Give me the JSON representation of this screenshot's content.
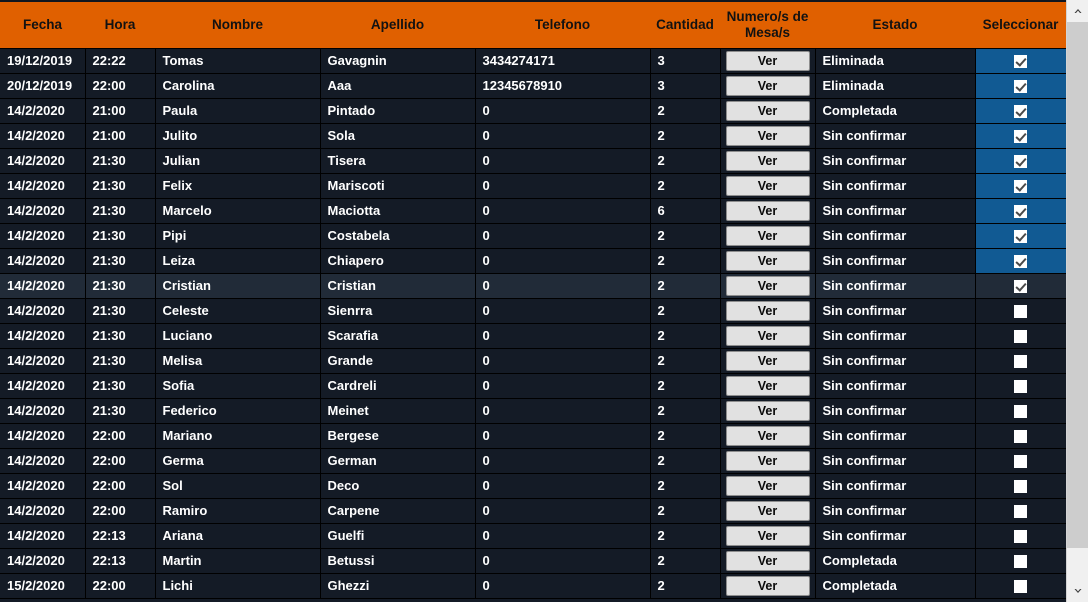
{
  "colors": {
    "header_orange": "#e06000",
    "row_background": "#141b26",
    "row_hover": "#212b38",
    "selected_cell_blue": "#115a93",
    "text_white": "#ffffff",
    "header_text": "#121212",
    "button_face": "#e1e1e1"
  },
  "table": {
    "columns": [
      {
        "key": "fecha",
        "label": "Fecha"
      },
      {
        "key": "hora",
        "label": "Hora"
      },
      {
        "key": "nombre",
        "label": "Nombre"
      },
      {
        "key": "apellido",
        "label": "Apellido"
      },
      {
        "key": "telefono",
        "label": "Telefono"
      },
      {
        "key": "cantidad",
        "label": "Cantidad"
      },
      {
        "key": "mesas",
        "label": "Numero/s de Mesa/s"
      },
      {
        "key": "estado",
        "label": "Estado"
      },
      {
        "key": "selec",
        "label": "Seleccionar"
      }
    ],
    "mesas_button_label": "Ver",
    "rows": [
      {
        "fecha": "19/12/2019",
        "hora": "22:22",
        "nombre": "Tomas",
        "apellido": "Gavagnin",
        "telefono": "3434274171",
        "cantidad": "3",
        "mesas": "Ver",
        "estado": "Eliminada",
        "checked": true,
        "hover": false
      },
      {
        "fecha": "20/12/2019",
        "hora": "22:00",
        "nombre": "Carolina",
        "apellido": "Aaa",
        "telefono": "12345678910",
        "cantidad": "3",
        "mesas": "Ver",
        "estado": "Eliminada",
        "checked": true,
        "hover": false
      },
      {
        "fecha": "14/2/2020",
        "hora": "21:00",
        "nombre": "Paula",
        "apellido": "Pintado",
        "telefono": "0",
        "cantidad": "2",
        "mesas": "Ver",
        "estado": "Completada",
        "checked": true,
        "hover": false
      },
      {
        "fecha": "14/2/2020",
        "hora": "21:00",
        "nombre": "Julito",
        "apellido": "Sola",
        "telefono": "0",
        "cantidad": "2",
        "mesas": "Ver",
        "estado": "Sin confirmar",
        "checked": true,
        "hover": false
      },
      {
        "fecha": "14/2/2020",
        "hora": "21:30",
        "nombre": "Julian",
        "apellido": "Tisera",
        "telefono": "0",
        "cantidad": "2",
        "mesas": "Ver",
        "estado": "Sin confirmar",
        "checked": true,
        "hover": false
      },
      {
        "fecha": "14/2/2020",
        "hora": "21:30",
        "nombre": "Felix",
        "apellido": "Mariscoti",
        "telefono": "0",
        "cantidad": "2",
        "mesas": "Ver",
        "estado": "Sin confirmar",
        "checked": true,
        "hover": false
      },
      {
        "fecha": "14/2/2020",
        "hora": "21:30",
        "nombre": "Marcelo",
        "apellido": "Maciotta",
        "telefono": "0",
        "cantidad": "6",
        "mesas": "Ver",
        "estado": "Sin confirmar",
        "checked": true,
        "hover": false
      },
      {
        "fecha": "14/2/2020",
        "hora": "21:30",
        "nombre": "Pipi",
        "apellido": "Costabela",
        "telefono": "0",
        "cantidad": "2",
        "mesas": "Ver",
        "estado": "Sin confirmar",
        "checked": true,
        "hover": false
      },
      {
        "fecha": "14/2/2020",
        "hora": "21:30",
        "nombre": "Leiza",
        "apellido": "Chiapero",
        "telefono": "0",
        "cantidad": "2",
        "mesas": "Ver",
        "estado": "Sin confirmar",
        "checked": true,
        "hover": false
      },
      {
        "fecha": "14/2/2020",
        "hora": "21:30",
        "nombre": "Cristian",
        "apellido": "Cristian",
        "telefono": "0",
        "cantidad": "2",
        "mesas": "Ver",
        "estado": "Sin confirmar",
        "checked": true,
        "hover": true
      },
      {
        "fecha": "14/2/2020",
        "hora": "21:30",
        "nombre": "Celeste",
        "apellido": "Sienrra",
        "telefono": "0",
        "cantidad": "2",
        "mesas": "Ver",
        "estado": "Sin confirmar",
        "checked": false,
        "hover": false
      },
      {
        "fecha": "14/2/2020",
        "hora": "21:30",
        "nombre": "Luciano",
        "apellido": "Scarafia",
        "telefono": "0",
        "cantidad": "2",
        "mesas": "Ver",
        "estado": "Sin confirmar",
        "checked": false,
        "hover": false
      },
      {
        "fecha": "14/2/2020",
        "hora": "21:30",
        "nombre": "Melisa",
        "apellido": "Grande",
        "telefono": "0",
        "cantidad": "2",
        "mesas": "Ver",
        "estado": "Sin confirmar",
        "checked": false,
        "hover": false
      },
      {
        "fecha": "14/2/2020",
        "hora": "21:30",
        "nombre": "Sofia",
        "apellido": "Cardreli",
        "telefono": "0",
        "cantidad": "2",
        "mesas": "Ver",
        "estado": "Sin confirmar",
        "checked": false,
        "hover": false
      },
      {
        "fecha": "14/2/2020",
        "hora": "21:30",
        "nombre": "Federico",
        "apellido": "Meinet",
        "telefono": "0",
        "cantidad": "2",
        "mesas": "Ver",
        "estado": "Sin confirmar",
        "checked": false,
        "hover": false
      },
      {
        "fecha": "14/2/2020",
        "hora": "22:00",
        "nombre": "Mariano",
        "apellido": "Bergese",
        "telefono": "0",
        "cantidad": "2",
        "mesas": "Ver",
        "estado": "Sin confirmar",
        "checked": false,
        "hover": false
      },
      {
        "fecha": "14/2/2020",
        "hora": "22:00",
        "nombre": "Germa",
        "apellido": "German",
        "telefono": "0",
        "cantidad": "2",
        "mesas": "Ver",
        "estado": "Sin confirmar",
        "checked": false,
        "hover": false
      },
      {
        "fecha": "14/2/2020",
        "hora": "22:00",
        "nombre": "Sol",
        "apellido": "Deco",
        "telefono": "0",
        "cantidad": "2",
        "mesas": "Ver",
        "estado": "Sin confirmar",
        "checked": false,
        "hover": false
      },
      {
        "fecha": "14/2/2020",
        "hora": "22:00",
        "nombre": "Ramiro",
        "apellido": "Carpene",
        "telefono": "0",
        "cantidad": "2",
        "mesas": "Ver",
        "estado": "Sin confirmar",
        "checked": false,
        "hover": false
      },
      {
        "fecha": "14/2/2020",
        "hora": "22:13",
        "nombre": "Ariana",
        "apellido": "Guelfi",
        "telefono": "0",
        "cantidad": "2",
        "mesas": "Ver",
        "estado": "Sin confirmar",
        "checked": false,
        "hover": false
      },
      {
        "fecha": "14/2/2020",
        "hora": "22:13",
        "nombre": "Martin",
        "apellido": "Betussi",
        "telefono": "0",
        "cantidad": "2",
        "mesas": "Ver",
        "estado": "Completada",
        "checked": false,
        "hover": false
      },
      {
        "fecha": "15/2/2020",
        "hora": "22:00",
        "nombre": "Lichi",
        "apellido": "Ghezzi",
        "telefono": "0",
        "cantidad": "2",
        "mesas": "Ver",
        "estado": "Completada",
        "checked": false,
        "hover": false
      }
    ]
  },
  "scrollbar": {
    "up_arrow": "chevron-up-icon",
    "down_arrow": "chevron-down-icon",
    "orientation": "vertical"
  }
}
